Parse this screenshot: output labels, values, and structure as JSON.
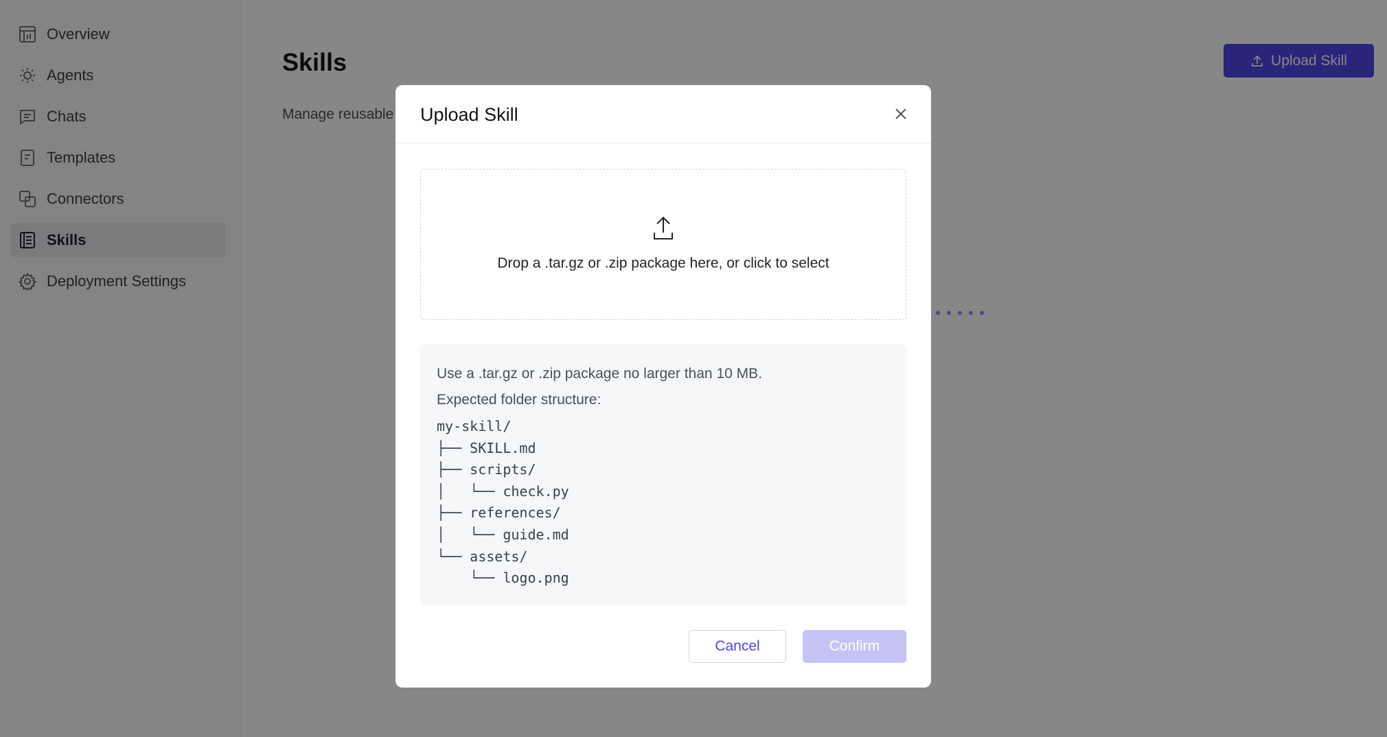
{
  "sidebar": {
    "items": [
      {
        "label": "Overview",
        "icon": "chart-board-icon"
      },
      {
        "label": "Agents",
        "icon": "sun-icon"
      },
      {
        "label": "Chats",
        "icon": "chat-icon"
      },
      {
        "label": "Templates",
        "icon": "document-icon"
      },
      {
        "label": "Connectors",
        "icon": "connector-icon"
      },
      {
        "label": "Skills",
        "icon": "skills-list-icon",
        "active": true
      },
      {
        "label": "Deployment Settings",
        "icon": "gear-icon"
      }
    ]
  },
  "main": {
    "title": "Skills",
    "description": "Manage reusable",
    "upload_button_label": "Upload Skill"
  },
  "modal": {
    "title": "Upload Skill",
    "dropzone_text": "Drop a .tar.gz or .zip package here, or click to select",
    "info_line_1": "Use a .tar.gz or .zip package no larger than 10 MB.",
    "info_line_2": "Expected folder structure:",
    "folder_tree": "my-skill/\n├── SKILL.md\n├── scripts/\n│   └── check.py\n├── references/\n│   └── guide.md\n└── assets/\n    └── logo.png",
    "cancel_label": "Cancel",
    "confirm_label": "Confirm"
  },
  "colors": {
    "accent": "#4f46e5",
    "accent_disabled": "#c7c3f7",
    "overlay": "rgba(0,0,0,0.47)"
  }
}
